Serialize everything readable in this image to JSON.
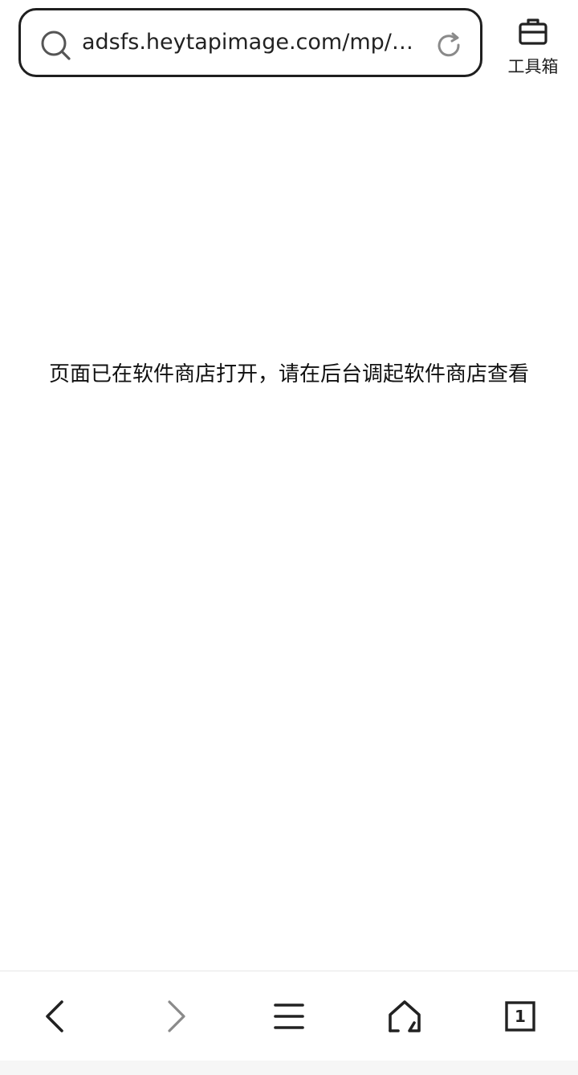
{
  "address_bar": {
    "url": "adsfs.heytapimage.com/mp/a…",
    "search_icon": "search-icon",
    "reload_icon": "reload-icon"
  },
  "toolbox": {
    "label": "工具箱",
    "icon": "briefcase-icon"
  },
  "main": {
    "message": "页面已在软件商店打开，请在后台调起软件商店查看"
  },
  "bottom_nav": {
    "back_icon": "chevron-left-icon",
    "forward_icon": "chevron-right-icon",
    "menu_icon": "menu-icon",
    "home_icon": "home-icon",
    "tabs_count": "1"
  },
  "colors": {
    "text": "#111111",
    "border": "#1f1f1f",
    "disabled": "#8a8a8a",
    "icon_gray": "#7a7a7a"
  }
}
